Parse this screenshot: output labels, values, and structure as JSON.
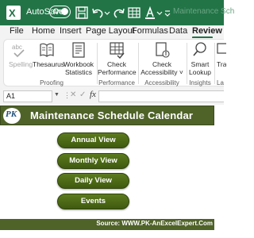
{
  "titlebar": {
    "autosave_label": "AutoSave",
    "autosave_state": "On",
    "filename": "Maintenance Sch"
  },
  "tabs": [
    {
      "label": "File",
      "active": false
    },
    {
      "label": "Home",
      "active": false
    },
    {
      "label": "Insert",
      "active": false
    },
    {
      "label": "Page Layout",
      "active": false
    },
    {
      "label": "Formulas",
      "active": false
    },
    {
      "label": "Data",
      "active": false
    },
    {
      "label": "Review",
      "active": true
    }
  ],
  "ribbon": {
    "proofing": {
      "spelling": "Spelling",
      "thesaurus": "Thesaurus",
      "workbook_statistics_1": "Workbook",
      "workbook_statistics_2": "Statistics",
      "group": "Proofing"
    },
    "performance": {
      "check_1": "Check",
      "check_2": "Performance",
      "group": "Performance"
    },
    "accessibility": {
      "check_1": "Check",
      "check_2": "Accessibility",
      "group": "Accessibility"
    },
    "insights": {
      "smart_1": "Smart",
      "smart_2": "Lookup",
      "group": "Insights"
    },
    "language": {
      "translate_partial": "Tra",
      "group_partial": "La"
    }
  },
  "formula_bar": {
    "name_box": "A1",
    "fx": "fx",
    "value": ""
  },
  "sheet": {
    "logo_text": "PK",
    "title": "Maintenance Schedule Calendar",
    "buttons": {
      "annual": "Annual View",
      "monthly": "Monthly View",
      "daily": "Daily View",
      "events": "Events"
    },
    "footer": "Source: WWW.PK-AnExcelExpert.Com"
  },
  "colors": {
    "excel_green": "#227447",
    "banner_olive": "#4f6228",
    "button_olive": "#4d6a17"
  }
}
